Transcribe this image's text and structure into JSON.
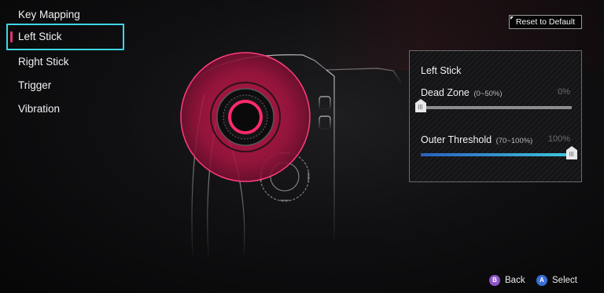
{
  "sidebar": {
    "items": [
      {
        "label": "Key Mapping",
        "active": false
      },
      {
        "label": "Left Stick",
        "active": true
      },
      {
        "label": "Right Stick",
        "active": false
      },
      {
        "label": "Trigger",
        "active": false
      },
      {
        "label": "Vibration",
        "active": false
      }
    ]
  },
  "header": {
    "reset_label": "Reset to Default"
  },
  "panel": {
    "title": "Left Stick",
    "dead_zone": {
      "label": "Dead Zone",
      "range": "(0~50%)",
      "value_text": "0%",
      "value": 0
    },
    "outer_threshold": {
      "label": "Outer Threshold",
      "range": "(70~100%)",
      "value_text": "100%",
      "value": 1.0
    }
  },
  "footer": {
    "back": {
      "glyph": "B",
      "label": "Back"
    },
    "select": {
      "glyph": "A",
      "label": "Select"
    }
  },
  "icons": [
    "controller-illustration",
    "b-button-icon",
    "a-button-icon"
  ],
  "colors": {
    "accent_cyan": "#3ed6e3",
    "accent_pink": "#e0336b",
    "slider_blue": "#2a5fbf"
  }
}
